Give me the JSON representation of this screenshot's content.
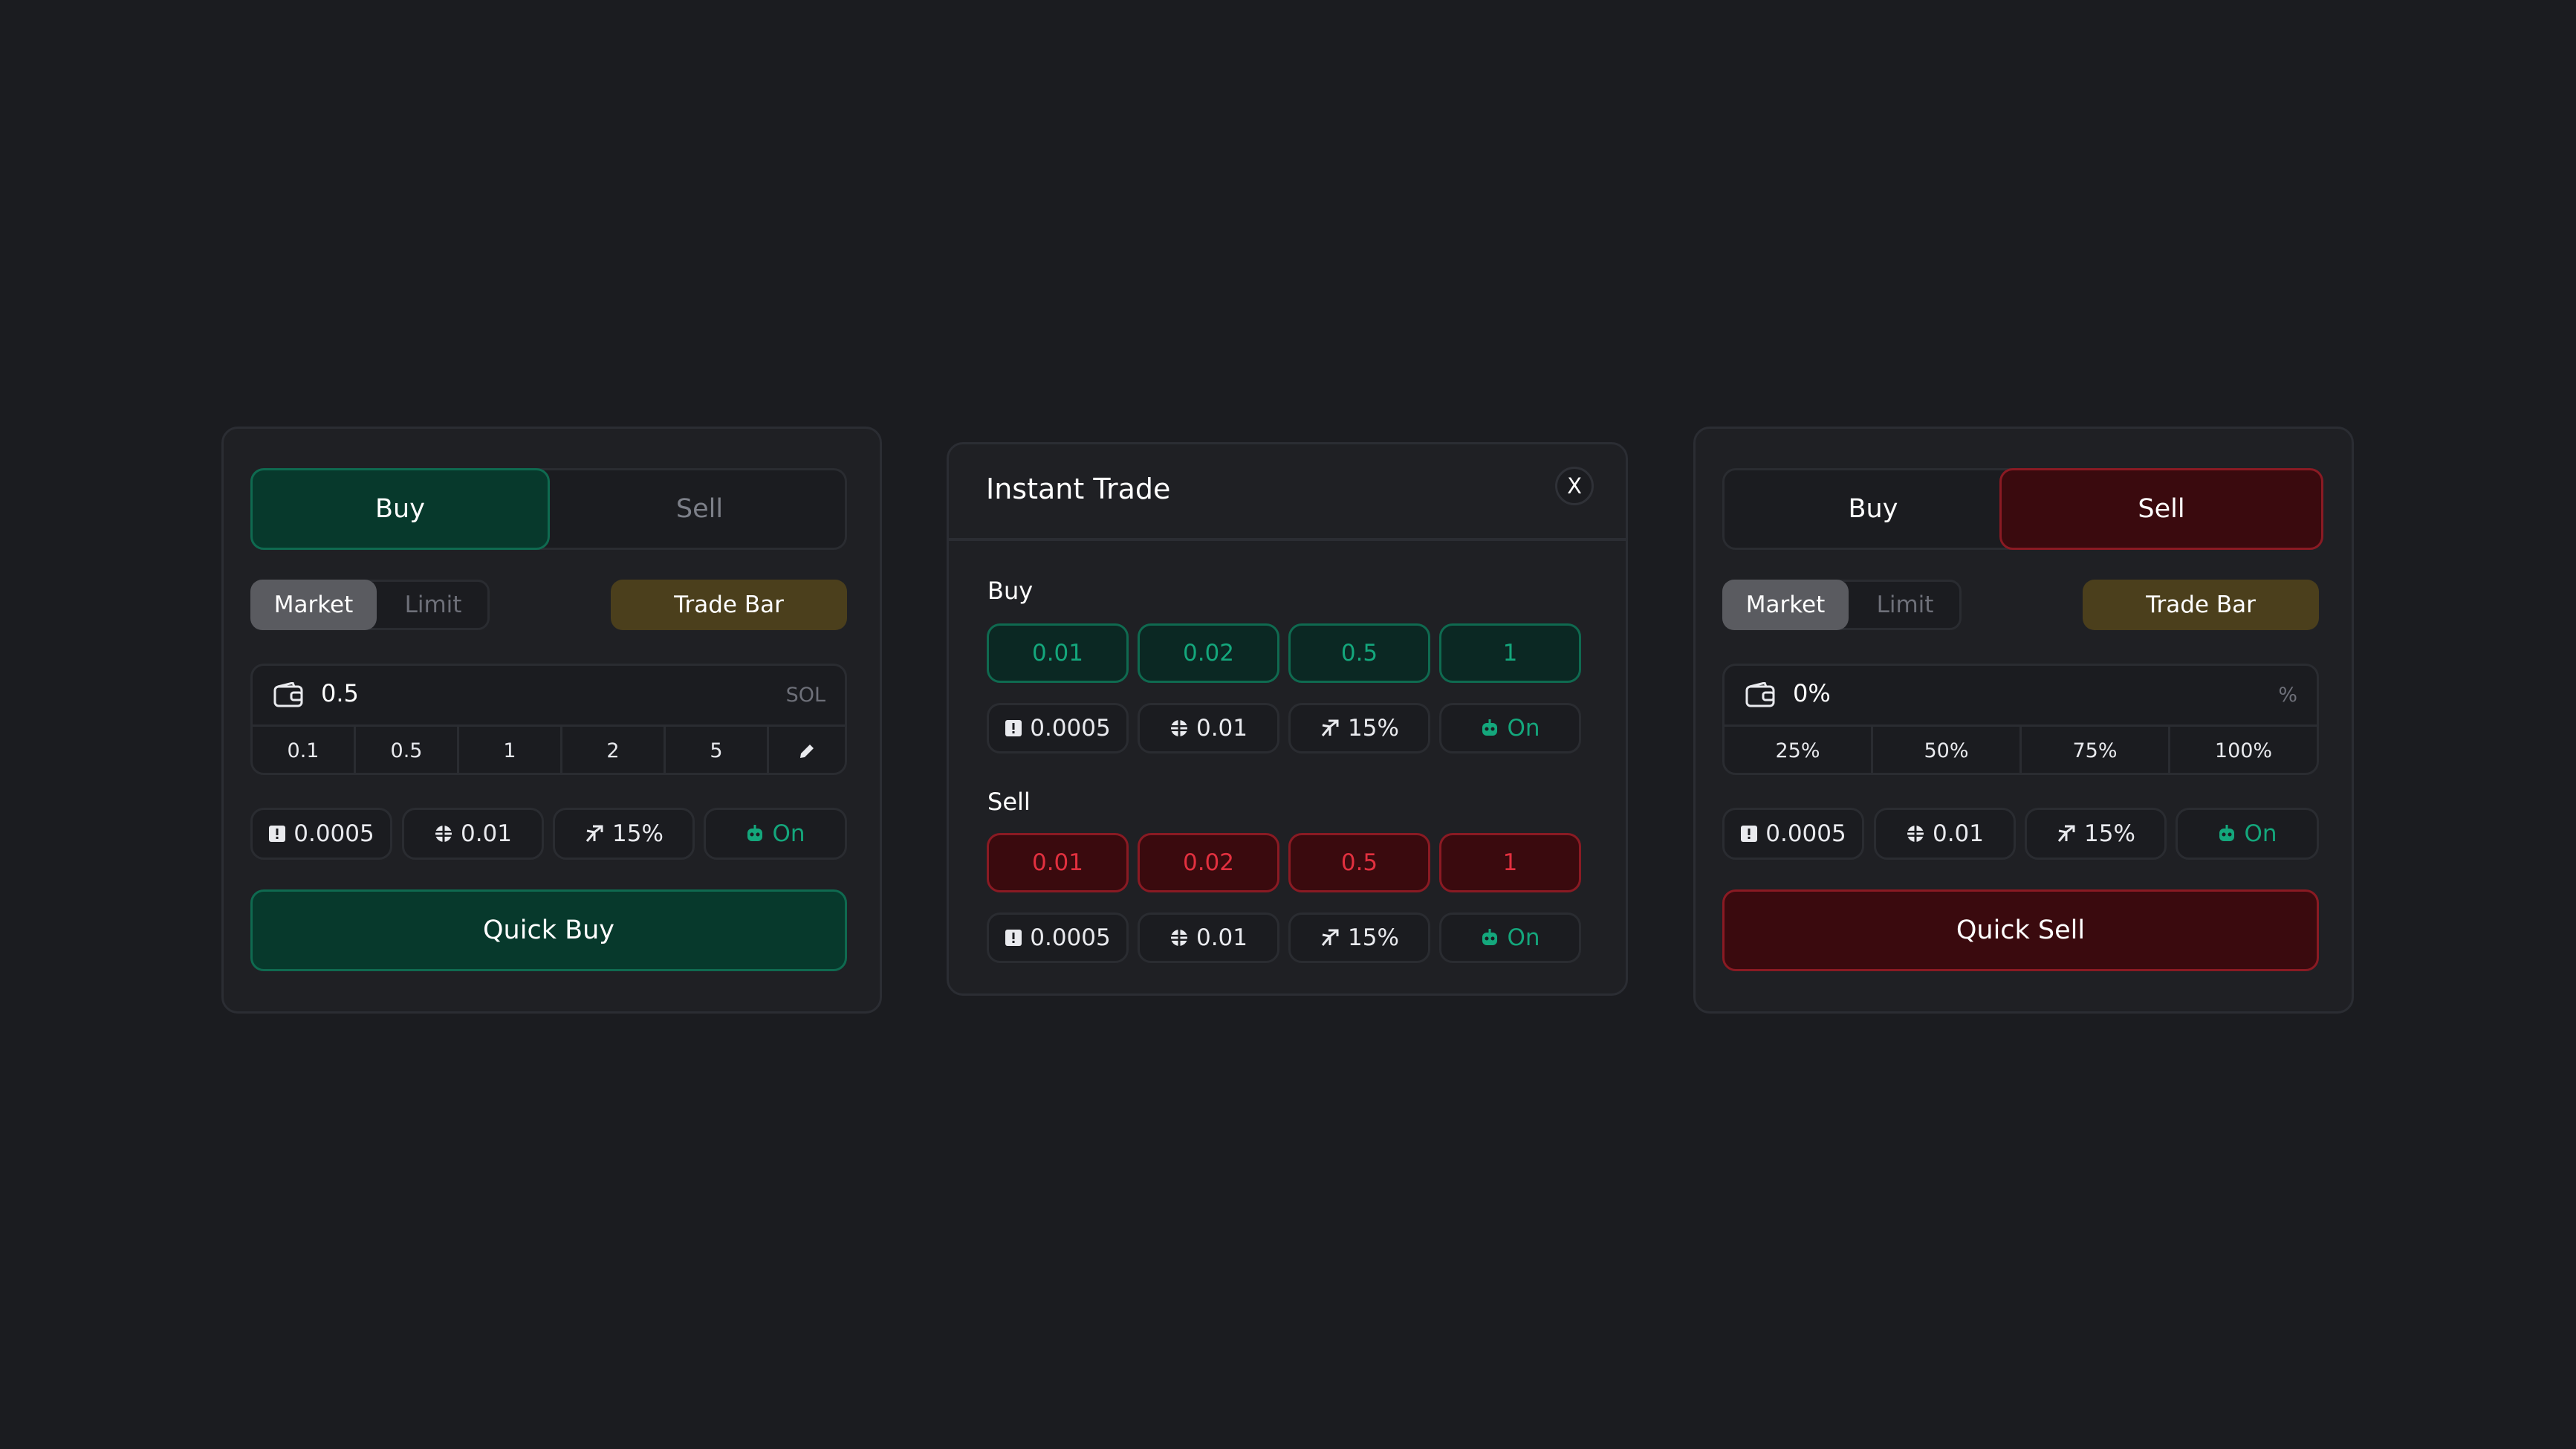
{
  "left_panel": {
    "tab_buy": "Buy",
    "tab_sell": "Sell",
    "order_market": "Market",
    "order_limit": "Limit",
    "trade_bar": "Trade Bar",
    "amount_value": "0.5",
    "amount_unit": "SOL",
    "presets": [
      "0.1",
      "0.5",
      "1",
      "2",
      "5"
    ],
    "settings": {
      "priority_fee": "0.0005",
      "bribe": "0.01",
      "slippage": "15%",
      "mev": "On"
    },
    "action": "Quick Buy"
  },
  "middle_panel": {
    "title": "Instant Trade",
    "close": "X",
    "buy_label": "Buy",
    "buy_amounts": [
      "0.01",
      "0.02",
      "0.5",
      "1"
    ],
    "buy_settings": {
      "priority_fee": "0.0005",
      "bribe": "0.01",
      "slippage": "15%",
      "mev": "On"
    },
    "sell_label": "Sell",
    "sell_amounts": [
      "0.01",
      "0.02",
      "0.5",
      "1"
    ],
    "sell_settings": {
      "priority_fee": "0.0005",
      "bribe": "0.01",
      "slippage": "15%",
      "mev": "On"
    }
  },
  "right_panel": {
    "tab_buy": "Buy",
    "tab_sell": "Sell",
    "order_market": "Market",
    "order_limit": "Limit",
    "trade_bar": "Trade Bar",
    "amount_value": "0%",
    "amount_unit": "%",
    "presets": [
      "25%",
      "50%",
      "75%",
      "100%"
    ],
    "settings": {
      "priority_fee": "0.0005",
      "bribe": "0.01",
      "slippage": "15%",
      "mev": "On"
    },
    "action": "Quick Sell"
  },
  "icons": {
    "wallet": "wallet-icon",
    "edit": "pencil-icon",
    "priority_fee": "alert-icon",
    "bribe": "coin-icon",
    "slippage": "slippage-icon",
    "mev": "robot-icon"
  },
  "colors": {
    "background": "#1b1c20",
    "panel": "#1f2024",
    "buy_green": "#14a77c",
    "buy_bg": "#07392c",
    "sell_red": "#e2303f",
    "sell_bg": "#3a0a0e",
    "trade_bar": "#4b3f1c"
  }
}
